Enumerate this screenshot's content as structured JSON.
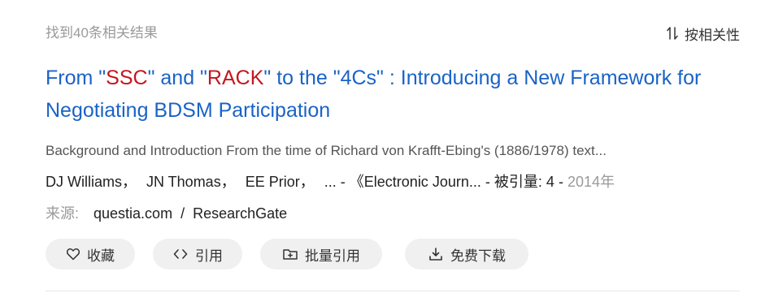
{
  "results_header": {
    "count_text": "找到40条相关结果",
    "sort_label": "按相关性"
  },
  "result": {
    "title": {
      "part1": "From \"",
      "hl1": "SSC",
      "part2": "\" and \"",
      "hl2": "RACK",
      "part3": "\" to the \"4Cs\" : Introducing a New Framework for Negotiating BDSM Participation"
    },
    "abstract": "Background and Introduction From the time of Richard von Krafft-Ebing's (1886/1978) text...",
    "authors": [
      "DJ Williams",
      "JN Thomas",
      "EE Prior"
    ],
    "author_sep": "，",
    "ellipsis": "...",
    "dash": "-",
    "journal": "《Electronic Journ...",
    "citations_label": "被引量:",
    "citations_value": "4",
    "year": "2014年",
    "source_label": "来源:",
    "sources": [
      "questia.com",
      "ResearchGate"
    ],
    "source_sep": "/"
  },
  "actions": {
    "favorite": "收藏",
    "cite": "引用",
    "batch_cite": "批量引用",
    "download": "免费下载"
  },
  "colors": {
    "title_link": "#1a63c6",
    "highlight": "#c4161c",
    "button_bg": "#f0f0f0"
  },
  "icons": [
    "sort-icon",
    "heart-icon",
    "code-icon",
    "folder-plus-icon",
    "download-icon"
  ]
}
